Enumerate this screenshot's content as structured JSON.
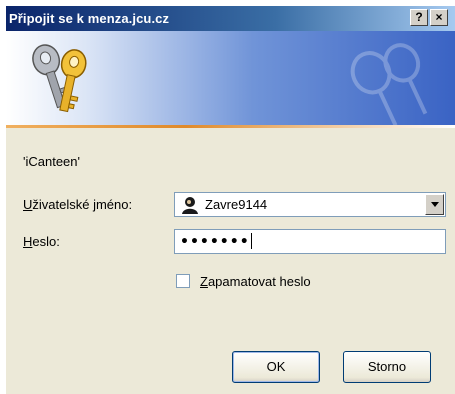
{
  "window": {
    "title": "Připojit se k menza.jcu.cz",
    "help_label": "?",
    "close_label": "×"
  },
  "realm": "'iCanteen'",
  "username": {
    "label_underlined": "U",
    "label_rest": "živatelské jméno:",
    "value": "Zavre9144"
  },
  "password": {
    "label_underlined": "H",
    "label_rest": "eslo:",
    "value": "•••••••"
  },
  "remember": {
    "label_underlined": "Z",
    "label_rest": "apamatovat heslo",
    "checked": false
  },
  "buttons": {
    "ok": "OK",
    "cancel": "Storno"
  },
  "colors": {
    "title_bar_start": "#0a246a",
    "banner_accent": "#3a63c4",
    "banner_line": "#e08a2a"
  }
}
